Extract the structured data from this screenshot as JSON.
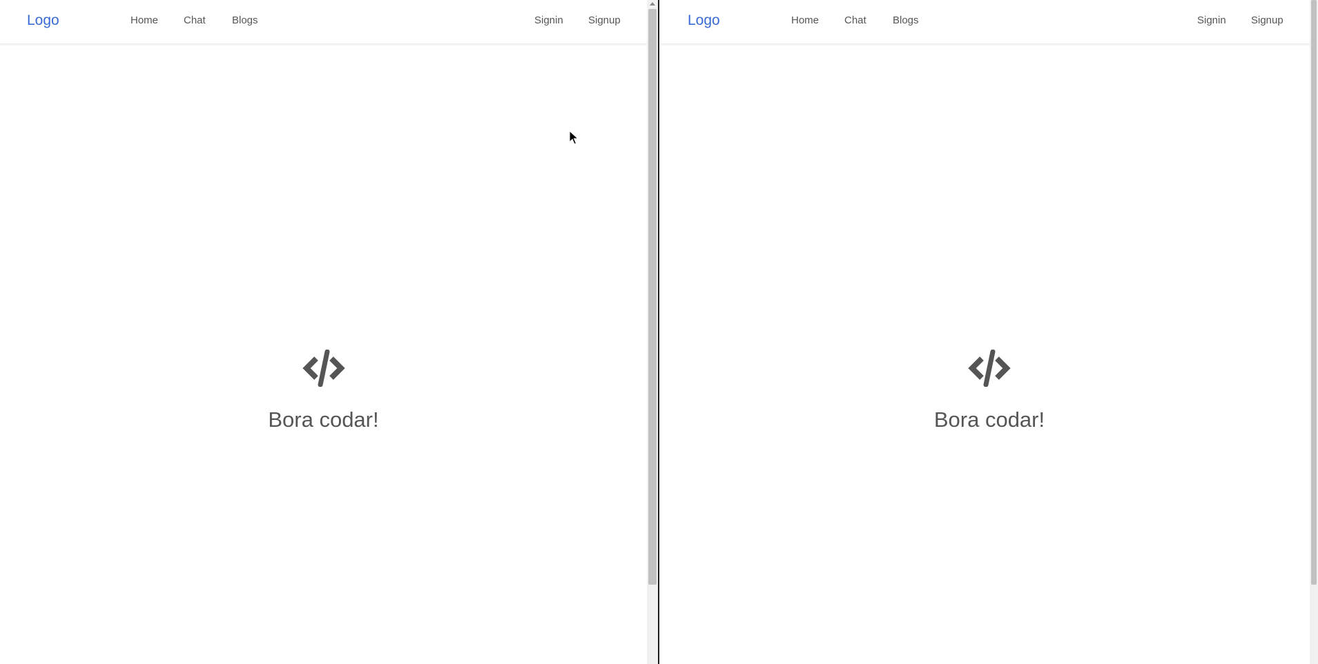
{
  "panes": [
    {
      "nav": {
        "logo": "Logo",
        "links": [
          "Home",
          "Chat",
          "Blogs"
        ],
        "signin": "Signin",
        "signup": "Signup"
      },
      "hero": {
        "icon": "code-icon",
        "title": "Bora codar!"
      }
    },
    {
      "nav": {
        "logo": "Logo",
        "links": [
          "Home",
          "Chat",
          "Blogs"
        ],
        "signin": "Signin",
        "signup": "Signup"
      },
      "hero": {
        "icon": "code-icon",
        "title": "Bora codar!"
      }
    }
  ],
  "colors": {
    "logo": "#3a6ad6",
    "text": "#555555",
    "background": "#ffffff"
  }
}
